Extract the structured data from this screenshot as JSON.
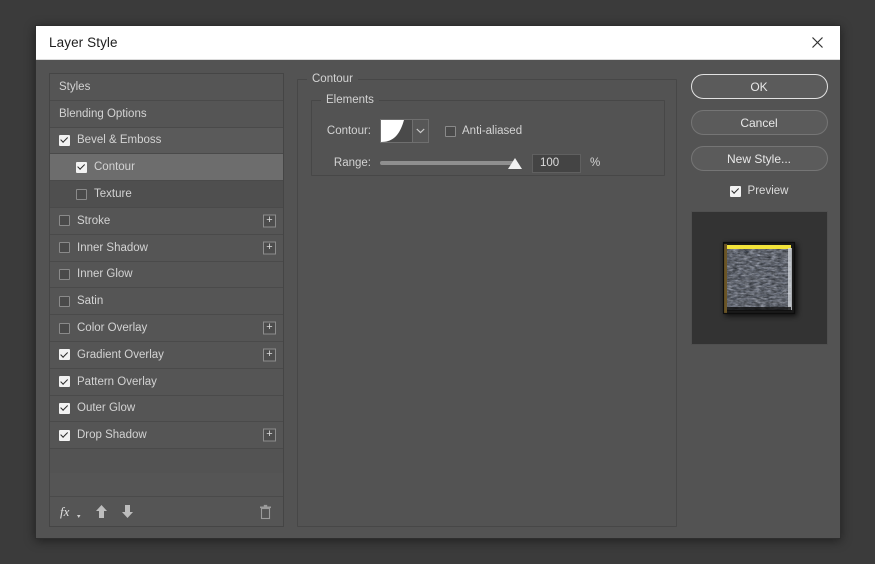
{
  "window": {
    "title": "Layer Style",
    "close_icon": "close-icon"
  },
  "sidebar": {
    "items": [
      {
        "label": "Styles",
        "kind": "plain",
        "checkbox": "none",
        "plus": false
      },
      {
        "label": "Blending Options",
        "kind": "plain",
        "checkbox": "none",
        "plus": false
      },
      {
        "label": "Bevel & Emboss",
        "kind": "group",
        "checkbox": "checked",
        "plus": false
      },
      {
        "label": "Contour",
        "kind": "sub-selected",
        "checkbox": "checked",
        "plus": false
      },
      {
        "label": "Texture",
        "kind": "sub",
        "checkbox": "unchecked",
        "plus": false
      },
      {
        "label": "Stroke",
        "kind": "plain",
        "checkbox": "unchecked",
        "plus": true
      },
      {
        "label": "Inner Shadow",
        "kind": "plain",
        "checkbox": "unchecked",
        "plus": true
      },
      {
        "label": "Inner Glow",
        "kind": "plain",
        "checkbox": "unchecked",
        "plus": false
      },
      {
        "label": "Satin",
        "kind": "plain",
        "checkbox": "unchecked",
        "plus": false
      },
      {
        "label": "Color Overlay",
        "kind": "plain",
        "checkbox": "unchecked",
        "plus": true
      },
      {
        "label": "Gradient Overlay",
        "kind": "plain",
        "checkbox": "checked",
        "plus": true
      },
      {
        "label": "Pattern Overlay",
        "kind": "plain",
        "checkbox": "checked",
        "plus": false
      },
      {
        "label": "Outer Glow",
        "kind": "plain",
        "checkbox": "checked",
        "plus": false
      },
      {
        "label": "Drop Shadow",
        "kind": "plain",
        "checkbox": "checked",
        "plus": true
      }
    ],
    "toolbar": {
      "fx_label": "fx",
      "fx_icon": "fx-icon",
      "move_up_icon": "arrow-up-icon",
      "move_down_icon": "arrow-down-icon",
      "delete_icon": "trash-icon"
    },
    "plus_label": "+"
  },
  "main": {
    "group_title": "Contour",
    "elements_title": "Elements",
    "contour": {
      "label": "Contour:",
      "swatch_icon": "contour-curve-swatch",
      "dropdown_icon": "chevron-down-icon",
      "anti_aliased_label": "Anti-aliased",
      "anti_aliased_checked": false
    },
    "range": {
      "label": "Range:",
      "value": "100",
      "unit": "%",
      "percent": 100
    }
  },
  "buttons": {
    "ok": "OK",
    "cancel": "Cancel",
    "new_style": "New Style...",
    "preview_label": "Preview",
    "preview_checked": true
  },
  "preview": {
    "thumbnail_icon": "layer-preview-thumbnail"
  },
  "colors": {
    "dialog_bg": "#535353",
    "titlebar_bg": "#ffffff",
    "row_bg": "#555555",
    "row_selected_bg": "#6d6d6d",
    "text": "#d3d3d3",
    "preview_bg": "#333333",
    "highlight_edge": "#f2e33a"
  }
}
